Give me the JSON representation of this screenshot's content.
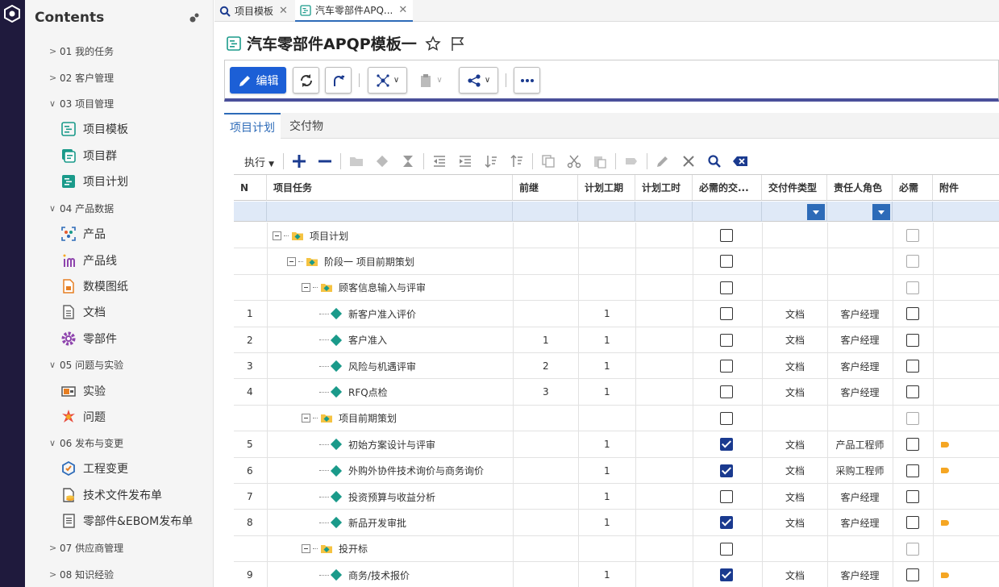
{
  "sidebar": {
    "title": "Contents",
    "groups": [
      {
        "label": "01 我的任务",
        "expanded": false
      },
      {
        "label": "02 客户管理",
        "expanded": false
      },
      {
        "label": "03 项目管理",
        "expanded": true,
        "items": [
          "项目模板",
          "项目群",
          "项目计划"
        ]
      },
      {
        "label": "04 产品数据",
        "expanded": true,
        "items": [
          "产品",
          "产品线",
          "数模图纸",
          "文档",
          "零部件"
        ]
      },
      {
        "label": "05 问题与实验",
        "expanded": true,
        "items": [
          "实验",
          "问题"
        ]
      },
      {
        "label": "06 发布与变更",
        "expanded": true,
        "items": [
          "工程变更",
          "技术文件发布单",
          "零部件&EBOM发布单"
        ]
      },
      {
        "label": "07 供应商管理",
        "expanded": false
      },
      {
        "label": "08 知识经验",
        "expanded": false
      }
    ]
  },
  "tabs": [
    {
      "label": "项目模板",
      "icon": "search-icon"
    },
    {
      "label": "汽车零部件APQ...",
      "icon": "document-icon",
      "active": true
    }
  ],
  "page": {
    "title": "汽车零部件APQP模板一"
  },
  "toolbar": {
    "edit_label": "编辑"
  },
  "subtabs": [
    "项目计划",
    "交付物"
  ],
  "gridbar": {
    "exec_label": "执行"
  },
  "table": {
    "columns": [
      "N",
      "项目任务",
      "前继",
      "计划工期",
      "计划工时",
      "必需的交...",
      "交付件类型",
      "责任人角色",
      "必需",
      "附件"
    ],
    "rows": [
      {
        "n": "",
        "task": "项目计划",
        "level": 0,
        "kind": "folder",
        "pred": "",
        "dur": "",
        "req": false,
        "type": "",
        "role": "",
        "must": "dim",
        "att": false
      },
      {
        "n": "",
        "task": "阶段一 项目前期策划",
        "level": 1,
        "kind": "folder",
        "pred": "",
        "dur": "",
        "req": false,
        "type": "",
        "role": "",
        "must": "dim",
        "att": false
      },
      {
        "n": "",
        "task": "顾客信息输入与评审",
        "level": 2,
        "kind": "folder",
        "pred": "",
        "dur": "",
        "req": false,
        "type": "",
        "role": "",
        "must": "dim",
        "att": false
      },
      {
        "n": "1",
        "task": "新客户准入评价",
        "level": 3,
        "kind": "task",
        "pred": "",
        "dur": "1",
        "req": false,
        "type": "文档",
        "role": "客户经理",
        "must": "off",
        "att": false
      },
      {
        "n": "2",
        "task": "客户准入",
        "level": 3,
        "kind": "task",
        "pred": "1",
        "dur": "1",
        "req": false,
        "type": "文档",
        "role": "客户经理",
        "must": "off",
        "att": false
      },
      {
        "n": "3",
        "task": "风险与机遇评审",
        "level": 3,
        "kind": "task",
        "pred": "2",
        "dur": "1",
        "req": false,
        "type": "文档",
        "role": "客户经理",
        "must": "off",
        "att": false
      },
      {
        "n": "4",
        "task": "RFQ点检",
        "level": 3,
        "kind": "task",
        "pred": "3",
        "dur": "1",
        "req": false,
        "type": "文档",
        "role": "客户经理",
        "must": "off",
        "att": false
      },
      {
        "n": "",
        "task": "项目前期策划",
        "level": 2,
        "kind": "folder",
        "pred": "",
        "dur": "",
        "req": false,
        "type": "",
        "role": "",
        "must": "dim",
        "att": false
      },
      {
        "n": "5",
        "task": "初始方案设计与评审",
        "level": 3,
        "kind": "task",
        "pred": "",
        "dur": "1",
        "req": true,
        "type": "文档",
        "role": "产品工程师",
        "must": "off",
        "att": true
      },
      {
        "n": "6",
        "task": "外购外协件技术询价与商务询价",
        "level": 3,
        "kind": "task",
        "pred": "",
        "dur": "1",
        "req": true,
        "type": "文档",
        "role": "采购工程师",
        "must": "off",
        "att": true
      },
      {
        "n": "7",
        "task": "投资预算与收益分析",
        "level": 3,
        "kind": "task",
        "pred": "",
        "dur": "1",
        "req": false,
        "type": "文档",
        "role": "客户经理",
        "must": "off",
        "att": false
      },
      {
        "n": "8",
        "task": "新品开发审批",
        "level": 3,
        "kind": "task",
        "pred": "",
        "dur": "1",
        "req": true,
        "type": "文档",
        "role": "客户经理",
        "must": "off",
        "att": true
      },
      {
        "n": "",
        "task": "投开标",
        "level": 2,
        "kind": "folder",
        "pred": "",
        "dur": "",
        "req": false,
        "type": "",
        "role": "",
        "must": "dim",
        "att": false
      },
      {
        "n": "9",
        "task": "商务/技术报价",
        "level": 3,
        "kind": "task",
        "pred": "",
        "dur": "1",
        "req": true,
        "type": "文档",
        "role": "客户经理",
        "must": "off",
        "att": true
      }
    ]
  }
}
